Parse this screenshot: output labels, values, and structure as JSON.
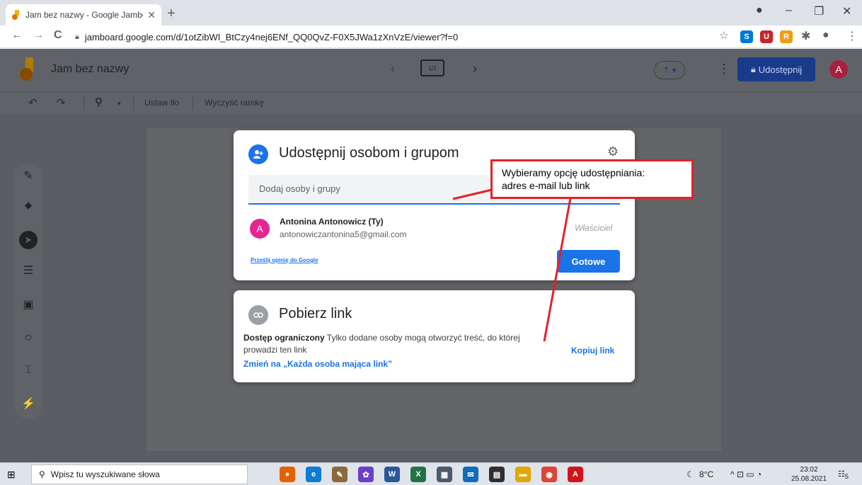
{
  "browser": {
    "tab_title": "Jam bez nazwy - Google Jamboa",
    "tab_close": "✕",
    "new_tab": "+",
    "url": "jamboard.google.com/d/1otZibWI_BtCzy4nej6ENf_QQ0QvZ-F0X5JWa1zXnVzE/viewer?f=0",
    "controls": {
      "minimize": "–",
      "restore": "❐",
      "close": "✕"
    },
    "nav": {
      "back": "←",
      "forward": "→",
      "reload": "C"
    },
    "star": "☆",
    "extensions": [
      {
        "name": "skype",
        "glyph": "S",
        "color": "#0078d4"
      },
      {
        "name": "ublock",
        "glyph": "U",
        "color": "#c7242a"
      },
      {
        "name": "rss",
        "glyph": "R",
        "color": "#f39c12"
      }
    ],
    "puzzle": "✱",
    "profile": "●",
    "menu": "⋮"
  },
  "jamboard": {
    "title": "Jam bez nazwy",
    "frame_counter": "1/1",
    "prev": "‹",
    "next": "›",
    "cast_label": "⇡ ▾",
    "kebab": "⋮",
    "share_label": "Udostępnij",
    "avatar_letter": "A",
    "toolbar": {
      "undo": "↶",
      "redo": "↷",
      "zoom": "⚲",
      "zoom_caret": "▾",
      "set_background": "Ustaw tło",
      "clear_frame": "Wyczyść ramkę"
    },
    "side_tools": [
      {
        "name": "pen-tool",
        "glyph": "✎"
      },
      {
        "name": "eraser-tool",
        "glyph": "◆"
      },
      {
        "name": "select-tool",
        "glyph": "➤"
      },
      {
        "name": "sticky-note-tool",
        "glyph": "☰"
      },
      {
        "name": "image-tool",
        "glyph": "▣"
      },
      {
        "name": "circle-tool",
        "glyph": "○"
      },
      {
        "name": "text-box-tool",
        "glyph": "⌶"
      },
      {
        "name": "laser-tool",
        "glyph": "⚡"
      }
    ]
  },
  "share_dialog": {
    "title": "Udostępnij osobom i grupom",
    "add_placeholder": "Dodaj osoby i grupy",
    "user": {
      "name": "Antonina Antonowicz (Ty)",
      "email": "antonowiczantonina5@gmail.com",
      "role": "Właściciel",
      "avatar_letter": "A"
    },
    "feedback_link": "Prześlij opinię do Google",
    "done_button": "Gotowe"
  },
  "link_dialog": {
    "title": "Pobierz link",
    "access_bold": "Dostęp ograniczony",
    "access_desc": " Tylko dodane osoby mogą otworzyć treść, do której prowadzi ten link",
    "change_link": "Zmień na „Każda osoba mająca link”",
    "copy_link": "Kopiuj link"
  },
  "annotation": {
    "line1": "Wybieramy opcję udostępniania:",
    "line2": "adres e-mail lub link",
    "color": "#e3222b"
  },
  "taskbar": {
    "search_placeholder": "Wpisz tu wyszukiwane słowa",
    "apps": [
      {
        "name": "firefox",
        "glyph": "●",
        "color": "#e66000"
      },
      {
        "name": "edge",
        "glyph": "e",
        "color": "#0c7cd5"
      },
      {
        "name": "paint",
        "glyph": "✎",
        "color": "#8a6a3c"
      },
      {
        "name": "recycle",
        "glyph": "✿",
        "color": "#6a3fc8"
      },
      {
        "name": "word",
        "glyph": "W",
        "color": "#2b579a"
      },
      {
        "name": "excel",
        "glyph": "X",
        "color": "#217346"
      },
      {
        "name": "calculator",
        "glyph": "▦",
        "color": "#4a5a6a"
      },
      {
        "name": "mail",
        "glyph": "✉",
        "color": "#0f6cbd"
      },
      {
        "name": "store",
        "glyph": "▤",
        "color": "#2f2f2f"
      },
      {
        "name": "files",
        "glyph": "▬",
        "color": "#e0a800"
      },
      {
        "name": "chrome",
        "glyph": "◉",
        "color": "#db4437"
      },
      {
        "name": "acrobat",
        "glyph": "A",
        "color": "#d4121a"
      }
    ],
    "weather": "8°C",
    "tray_icons": "^ ⊡ ▭ ◔",
    "time": "23:02",
    "date": "25.08.2021",
    "notifications": "5"
  }
}
